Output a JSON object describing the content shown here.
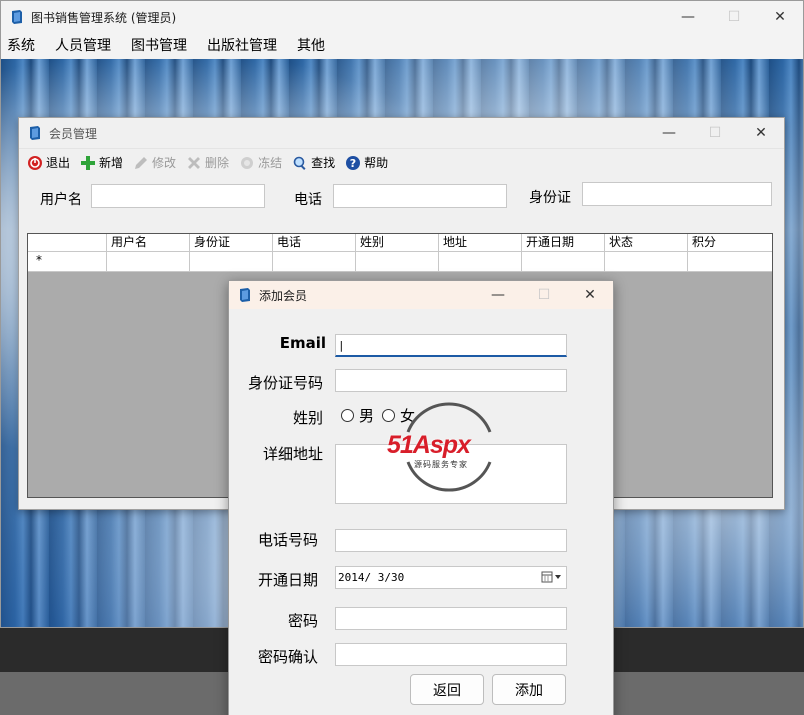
{
  "main_window": {
    "title": "图书销售管理系统 (管理员)",
    "controls": {
      "minimize": "—",
      "maximize": "☐",
      "close": "✕"
    }
  },
  "menubar": {
    "items": [
      "系统",
      "人员管理",
      "图书管理",
      "出版社管理",
      "其他"
    ]
  },
  "member_window": {
    "title": "会员管理",
    "toolbar": [
      {
        "label": "退出",
        "icon": "exit-icon",
        "enabled": true
      },
      {
        "label": "新增",
        "icon": "add-icon",
        "enabled": true
      },
      {
        "label": "修改",
        "icon": "edit-icon",
        "enabled": false
      },
      {
        "label": "删除",
        "icon": "delete-icon",
        "enabled": false
      },
      {
        "label": "冻结",
        "icon": "freeze-icon",
        "enabled": false
      },
      {
        "label": "查找",
        "icon": "search-icon",
        "enabled": true
      },
      {
        "label": "帮助",
        "icon": "help-icon",
        "enabled": true
      }
    ],
    "search": {
      "username_label": "用户名",
      "phone_label": "电话",
      "id_label": "身份证"
    },
    "grid": {
      "columns": [
        "用户名",
        "身份证",
        "电话",
        "姓别",
        "地址",
        "开通日期",
        "状态",
        "积分"
      ],
      "new_row_marker": "*"
    }
  },
  "add_dialog": {
    "title": "添加会员",
    "fields": {
      "email": {
        "label": "Email",
        "value": "|"
      },
      "id_number": {
        "label": "身份证号码",
        "value": ""
      },
      "gender": {
        "label": "姓别",
        "options": [
          "男",
          "女"
        ]
      },
      "address": {
        "label": "详细地址",
        "value": ""
      },
      "phone": {
        "label": "电话号码",
        "value": ""
      },
      "open_date": {
        "label": "开通日期",
        "value": "2014/ 3/30"
      },
      "password": {
        "label": "密码",
        "value": ""
      },
      "password_confirm": {
        "label": "密码确认",
        "value": ""
      }
    },
    "buttons": {
      "back": "返回",
      "add": "添加"
    }
  },
  "watermark": {
    "brand": "51Aspx",
    "tagline": "源码服务专家"
  },
  "colors": {
    "accent": "#1c5aa5",
    "exit_red": "#d22222",
    "add_green": "#2fa43a",
    "watermark_red": "#d81e2a",
    "watermark_green": "#3a9b3a"
  }
}
